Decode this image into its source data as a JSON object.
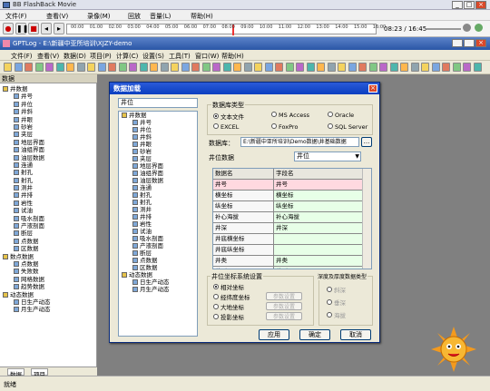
{
  "title_bar": {
    "title": "BB FlashBack Movie"
  },
  "player_menu": [
    "文件(F)",
    "查看(V)",
    "录像(M)",
    "回放",
    "音量(L)",
    "帮助(H)"
  ],
  "timeline": {
    "ticks": [
      "00:00",
      "01:00",
      "02:00",
      "03:00",
      "04:00",
      "05:00",
      "06:00",
      "07:00",
      "08:00",
      "09:00",
      "10:00",
      "11:00",
      "12:00",
      "13:00",
      "14:00",
      "15:00",
      "16:00"
    ],
    "time": "08:23 / 16:45"
  },
  "app_title": "GPTLog - E:\\新疆中亚所培训\\XJZY-demo",
  "app_menu": [
    "文件(F)",
    "查看(V)",
    "数据(D)",
    "项目(P)",
    "计算(C)",
    "设置(S)",
    "工具(T)",
    "窗口(W)",
    "帮助(H)"
  ],
  "left_panel": {
    "header": "数据",
    "tree": [
      {
        "l": 0,
        "t": "井数据",
        "f": 1
      },
      {
        "l": 1,
        "t": "井号"
      },
      {
        "l": 1,
        "t": "井位"
      },
      {
        "l": 1,
        "t": "井斜"
      },
      {
        "l": 1,
        "t": "井眼"
      },
      {
        "l": 1,
        "t": "砂岩"
      },
      {
        "l": 1,
        "t": "夹层"
      },
      {
        "l": 1,
        "t": "地层界面"
      },
      {
        "l": 1,
        "t": "油组界面"
      },
      {
        "l": 1,
        "t": "油层数据"
      },
      {
        "l": 1,
        "t": "连通"
      },
      {
        "l": 1,
        "t": "射孔"
      },
      {
        "l": 1,
        "t": "射孔"
      },
      {
        "l": 1,
        "t": "测井"
      },
      {
        "l": 1,
        "t": "井排"
      },
      {
        "l": 1,
        "t": "岩性"
      },
      {
        "l": 1,
        "t": "试油"
      },
      {
        "l": 1,
        "t": "吸水剖面"
      },
      {
        "l": 1,
        "t": "产液剖面"
      },
      {
        "l": 1,
        "t": "断层"
      },
      {
        "l": 1,
        "t": "点数据"
      },
      {
        "l": 1,
        "t": "区数据"
      },
      {
        "l": 0,
        "t": "数点数据",
        "f": 1
      },
      {
        "l": 1,
        "t": "点数据"
      },
      {
        "l": 1,
        "t": "失败数"
      },
      {
        "l": 1,
        "t": "网格数据"
      },
      {
        "l": 1,
        "t": "趋势数据"
      },
      {
        "l": 0,
        "t": "动态数据",
        "f": 1
      },
      {
        "l": 1,
        "t": "日生产动态"
      },
      {
        "l": 1,
        "t": "月生产动态"
      }
    ],
    "tabs": [
      "数据",
      "项目"
    ]
  },
  "dialog": {
    "title": "数据加载",
    "search_value": "井位",
    "tree": [
      {
        "l": 0,
        "t": "井数据"
      },
      {
        "l": 1,
        "t": "井号"
      },
      {
        "l": 1,
        "t": "井位"
      },
      {
        "l": 1,
        "t": "井斜"
      },
      {
        "l": 1,
        "t": "井眼"
      },
      {
        "l": 1,
        "t": "砂岩"
      },
      {
        "l": 1,
        "t": "夹层"
      },
      {
        "l": 1,
        "t": "地层界面"
      },
      {
        "l": 1,
        "t": "油组界面"
      },
      {
        "l": 1,
        "t": "油层数据"
      },
      {
        "l": 1,
        "t": "连通"
      },
      {
        "l": 1,
        "t": "射孔"
      },
      {
        "l": 1,
        "t": "射孔"
      },
      {
        "l": 1,
        "t": "测井"
      },
      {
        "l": 1,
        "t": "井排"
      },
      {
        "l": 1,
        "t": "岩性"
      },
      {
        "l": 1,
        "t": "试油"
      },
      {
        "l": 1,
        "t": "吸水剖面"
      },
      {
        "l": 1,
        "t": "产液剖面"
      },
      {
        "l": 1,
        "t": "断层"
      },
      {
        "l": 1,
        "t": "点数据"
      },
      {
        "l": 1,
        "t": "区数据"
      },
      {
        "l": 0,
        "t": "动态数据"
      },
      {
        "l": 1,
        "t": "日生产动态"
      },
      {
        "l": 1,
        "t": "月生产动态"
      }
    ],
    "db_type_label": "数据库类型",
    "db_types": [
      "文本文件",
      "MS Access",
      "Oracle",
      "EXCEL",
      "FoxPro",
      "SQL Server"
    ],
    "db_label": "数据库：",
    "db_path": "E:\\新疆中亚所培训\\Demo数据\\井基础数据",
    "well_label": "井位数据",
    "well_select": "井位",
    "table_headers": [
      "数据名",
      "字段名"
    ],
    "table_rows": [
      [
        "井号",
        "井号"
      ],
      [
        "横坐标",
        "横坐标"
      ],
      [
        "纵坐标",
        "纵坐标"
      ],
      [
        "补心海拔",
        "补心海拔"
      ],
      [
        "井深",
        "井深"
      ],
      [
        "井底横坐标",
        ""
      ],
      [
        "井底纵坐标",
        ""
      ],
      [
        "井类",
        "井类"
      ],
      [
        "井型",
        "井型"
      ]
    ],
    "coord_group": "井位坐标系统设置",
    "coord_opts": [
      "相对坐标",
      "经纬度坐标",
      "大地坐标",
      "投影坐标"
    ],
    "param_btn": "参数设置",
    "depth_group": "深度及厚度数据类型",
    "depth_opts": [
      "斜深",
      "垂深",
      "海拔"
    ],
    "btn_apply": "应用",
    "btn_ok": "确定",
    "btn_cancel": "取消"
  },
  "status": "就绪"
}
